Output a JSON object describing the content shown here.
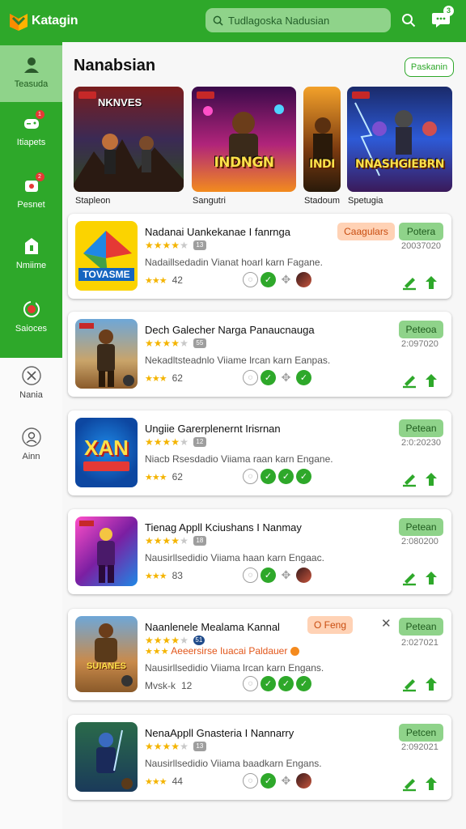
{
  "app": {
    "name": "Katagin",
    "search_placeholder": "Tudlagoska Nadusian",
    "chat_badge": "3"
  },
  "colors": {
    "brand_green": "#2ea82a",
    "light_green": "#8fd38a",
    "star_yellow": "#f4b400",
    "tag_orange": "#ffd2b5"
  },
  "sidebar": {
    "items": [
      {
        "label": "Teasuda",
        "icon": "user-icon",
        "active": true
      },
      {
        "label": "Itiapets",
        "icon": "gamepad-icon",
        "badge": "1"
      },
      {
        "label": "Pesnet",
        "icon": "puzzle-icon",
        "badge": "2"
      },
      {
        "label": "Nmiime",
        "icon": "store-icon"
      },
      {
        "label": "Saioces",
        "icon": "refresh-icon"
      },
      {
        "label": "Nania",
        "icon": "close-icon"
      },
      {
        "label": "Ainn",
        "icon": "account-icon"
      }
    ]
  },
  "section": {
    "title": "Nanabsian",
    "see_all": "Paskanin"
  },
  "featured": [
    {
      "art": "NKNVES",
      "label": "Stapleon"
    },
    {
      "art": "INDNGN",
      "label": "Sangutri"
    },
    {
      "art": "INDI",
      "label": "Stadoum"
    },
    {
      "art": "NNASHGIEBRN",
      "label": "Spetugia"
    }
  ],
  "apps": [
    {
      "name": "Nadanai Uankekanae I fanrnga",
      "desc": "Nadaillsedadin Vianat hoarl karn Fagane.",
      "stars": 4,
      "badge": "13",
      "rating": "42",
      "status": "Potera",
      "date": "20037020",
      "tag": "Caagulars",
      "icon_text": "TOVASME",
      "features": [
        "ghost",
        "ok",
        "puzzle",
        "avatar"
      ]
    },
    {
      "name": "Dech Galecher Narga Panaucnauga",
      "desc": "Nekadltsteadnlo Viiame lrcan karn Eanpas.",
      "stars": 4,
      "badge": "55",
      "rating": "62",
      "status": "Peteoa",
      "date": "2:097020",
      "icon_text": "",
      "features": [
        "ghost",
        "ok",
        "puzzle",
        "ok"
      ]
    },
    {
      "name": "Ungiie Garerplenernt Irisrnan",
      "desc": "Niacb Rsesdadio Viiama raan karn Engane.",
      "stars": 4,
      "badge": "12",
      "rating": "62",
      "status": "Petean",
      "date": "2:0:20230",
      "icon_text": "XAN",
      "features": [
        "ghost",
        "ok",
        "ok",
        "ok"
      ]
    },
    {
      "name": "Tienag Appll Kciushans I Nanmay",
      "desc": "Nausirllsedidio Viiama haan karn Engaac.",
      "stars": 4,
      "badge": "18",
      "rating": "83",
      "status": "Petean",
      "date": "2:080200",
      "icon_text": "",
      "features": [
        "ghost",
        "ok",
        "puzzle",
        "avatar"
      ]
    },
    {
      "name": "Naanlenele Mealama Kannal",
      "desc": "Nausirllsedidio Viiama lrcan karn Engans.",
      "stars": 4,
      "badge": "51",
      "rating": "12",
      "rating_prefix": "Mvsk-k",
      "status": "Petean",
      "date": "2:027021",
      "tag": "O Feng",
      "promo": "Aeeersirse Iuacai Paldauer",
      "icon_text": "SUIANES",
      "features": [
        "ghost",
        "ok",
        "ok",
        "ok"
      ]
    },
    {
      "name": "NenaAppll Gnasteria I Nannarry",
      "desc": "Nausirllsedidio Viiama baadkarn Engans.",
      "stars": 4,
      "badge": "13",
      "rating": "44",
      "status": "Petcen",
      "date": "2:092021",
      "icon_text": "",
      "features": [
        "ghost",
        "ok",
        "puzzle",
        "avatar"
      ]
    }
  ]
}
